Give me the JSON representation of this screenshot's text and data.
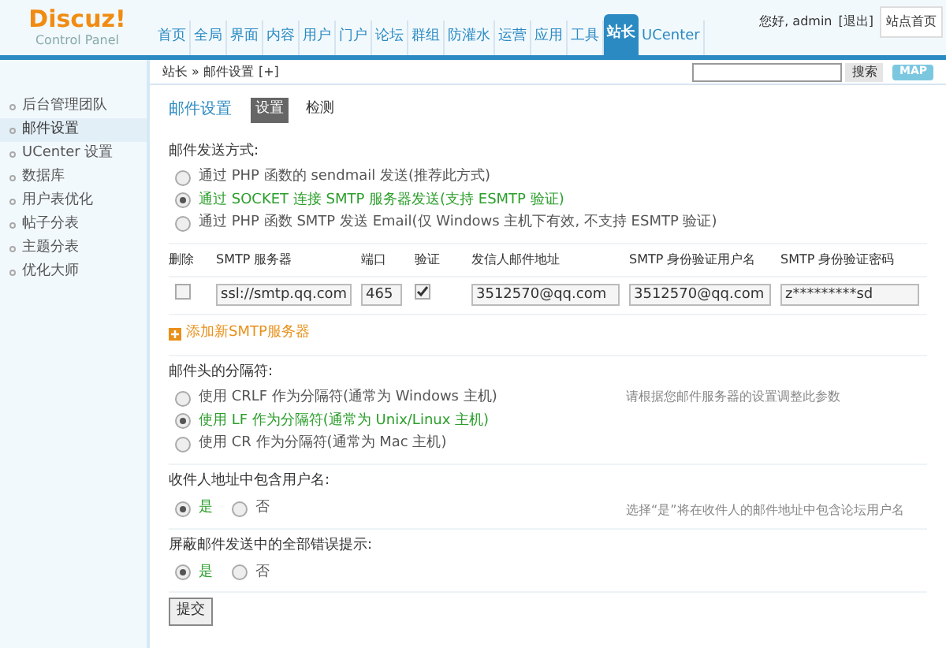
{
  "logo": {
    "name": "Discuz!",
    "subtitle": "Control Panel"
  },
  "nav": [
    {
      "label": "首页",
      "selected": false
    },
    {
      "label": "全局",
      "selected": false
    },
    {
      "label": "界面",
      "selected": false
    },
    {
      "label": "内容",
      "selected": false
    },
    {
      "label": "用户",
      "selected": false
    },
    {
      "label": "门户",
      "selected": false
    },
    {
      "label": "论坛",
      "selected": false
    },
    {
      "label": "群组",
      "selected": false
    },
    {
      "label": "防灌水",
      "selected": false
    },
    {
      "label": "运营",
      "selected": false
    },
    {
      "label": "应用",
      "selected": false
    },
    {
      "label": "工具",
      "selected": false
    },
    {
      "label": "站长",
      "selected": true
    },
    {
      "label": "UCenter",
      "selected": false
    }
  ],
  "user": {
    "greeting": "您好, admin",
    "logout": "[退出]",
    "home": "站点首页"
  },
  "breadcrumb": {
    "text": "站长 » 邮件设置",
    "add": "[+]"
  },
  "search": {
    "button": "搜索"
  },
  "map_button": "MAP",
  "sidebar": [
    {
      "label": "后台管理团队",
      "selected": false
    },
    {
      "label": "邮件设置",
      "selected": true
    },
    {
      "label": "UCenter 设置",
      "selected": false
    },
    {
      "label": "数据库",
      "selected": false
    },
    {
      "label": "用户表优化",
      "selected": false
    },
    {
      "label": "帖子分表",
      "selected": false
    },
    {
      "label": "主题分表",
      "selected": false
    },
    {
      "label": "优化大师",
      "selected": false
    }
  ],
  "page_title": "邮件设置",
  "tabs": [
    {
      "label": "设置",
      "selected": true
    },
    {
      "label": "检测",
      "selected": false
    }
  ],
  "sections": [
    {
      "kind": "radio_list",
      "title": "邮件发送方式:",
      "options": [
        {
          "label": "通过 PHP 函数的 sendmail 发送(推荐此方式)",
          "selected": false
        },
        {
          "label": "通过 SOCKET 连接 SMTP 服务器发送(支持 ESMTP 验证)",
          "selected": true
        },
        {
          "label": "通过 PHP 函数 SMTP 发送 Email(仅 Windows 主机下有效, 不支持 ESMTP 验证)",
          "selected": false
        }
      ]
    },
    {
      "kind": "smtp_table",
      "columns": [
        "删除",
        "SMTP 服务器",
        "端口",
        "验证",
        "发信人邮件地址",
        "SMTP 身份验证用户名",
        "SMTP 身份验证密码"
      ],
      "rows": [
        {
          "delete": false,
          "server": "ssl://smtp.qq.com",
          "port": "465",
          "auth": true,
          "from": "3512570@qq.com",
          "user": "3512570@qq.com",
          "password": "z*********sd"
        }
      ],
      "add_link": "添加新SMTP服务器"
    },
    {
      "kind": "radio_list",
      "title": "邮件头的分隔符:",
      "note": "请根据您邮件服务器的设置调整此参数",
      "options": [
        {
          "label": "使用 CRLF 作为分隔符(通常为 Windows 主机)",
          "selected": false
        },
        {
          "label": "使用 LF 作为分隔符(通常为 Unix/Linux 主机)",
          "selected": true
        },
        {
          "label": "使用 CR 作为分隔符(通常为 Mac 主机)",
          "selected": false
        }
      ]
    },
    {
      "kind": "radio_inline",
      "title": "收件人地址中包含用户名:",
      "note": "选择“是”将在收件人的邮件地址中包含论坛用户名",
      "options": [
        {
          "label": "是",
          "selected": true
        },
        {
          "label": "否",
          "selected": false
        }
      ]
    },
    {
      "kind": "radio_inline",
      "title": "屏蔽邮件发送中的全部错误提示:",
      "options": [
        {
          "label": "是",
          "selected": true
        },
        {
          "label": "否",
          "selected": false
        }
      ]
    }
  ],
  "submit": "提交"
}
